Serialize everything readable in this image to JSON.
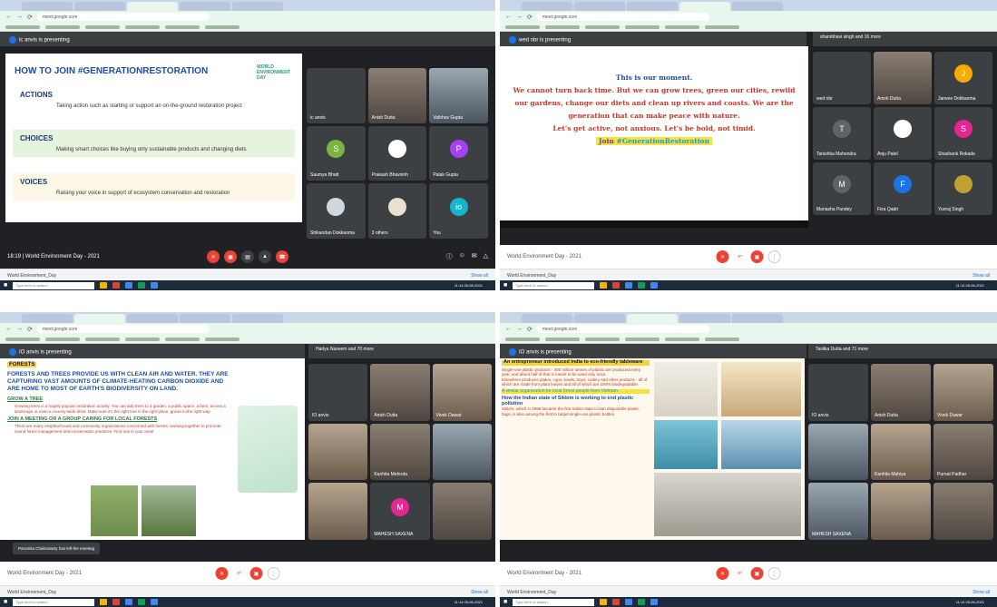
{
  "shot1": {
    "banner": "ic anvis is presenting",
    "slide": {
      "title": "HOW TO JOIN #GENERATIONRESTORATION",
      "logo": "WORLD ENVIRONMENT DAY",
      "sections": [
        {
          "title": "ACTIONS",
          "text": "Taking action such as starting or support an on-the-ground restoration project"
        },
        {
          "title": "CHOICES",
          "text": "Making smart choices like buying only sustainable products and changing diets"
        },
        {
          "title": "VOICES",
          "text": "Raising your voice in support of ecosystem conservation and restoration"
        }
      ]
    },
    "tiles": [
      {
        "name": "ic anvis",
        "letter": "",
        "color": "#3c4043"
      },
      {
        "name": "Anish Dutta",
        "letter": "",
        "color": ""
      },
      {
        "name": "Vaibhav Gupta",
        "letter": "",
        "color": "#3c4043"
      },
      {
        "name": "Saumya Bhatt",
        "letter": "S",
        "color": "#7cb342"
      },
      {
        "name": "Prakash Bhavsinh",
        "letter": "",
        "color": "#3c4043"
      },
      {
        "name": "Palak Gupta",
        "letter": "P",
        "color": "#a142f4"
      },
      {
        "name": "Shikandan Dokkaoma",
        "letter": "",
        "color": "#3c4043"
      },
      {
        "name": "3 others",
        "letter": "",
        "color": "#3c4043"
      },
      {
        "name": "You",
        "letter": "io",
        "color": "#12b5cb"
      }
    ],
    "meeting": "18:19 | World Environment Day - 2021"
  },
  "shot2": {
    "banner": "wed nbr is presenting",
    "participants_note": "shambhavi singh and 16 more",
    "moment": {
      "heading": "This is our moment.",
      "body": "We cannot turn back time. But we can grow trees, green our cities, rewild our gardens, change our diets and clean up rivers and coasts. We are the generation that can make peace with nature.",
      "tagline": "Let's get active, not anxious. Let's be bold, not timid.",
      "join": "Join",
      "hashtag": "#GenerationRestoration"
    },
    "tiles": [
      {
        "name": "wed nbr",
        "letter": "",
        "color": ""
      },
      {
        "name": "Anish Dutta",
        "letter": "",
        "color": ""
      },
      {
        "name": "Janvee Dokkaoma",
        "letter": "J",
        "color": "#f9ab00"
      },
      {
        "name": "Tanishka Mahendra",
        "letter": "T",
        "color": "#5f6368"
      },
      {
        "name": "Anju Patel",
        "letter": "",
        "color": "#3c4043"
      },
      {
        "name": "Shashank Rokade",
        "letter": "S",
        "color": "#e52592"
      },
      {
        "name": "Manasha Pandey",
        "letter": "M",
        "color": "#5f6368"
      },
      {
        "name": "Fiza Qadri",
        "letter": "F",
        "color": "#1a73e8"
      },
      {
        "name": "Yuvraj Singh",
        "letter": "",
        "color": "#3c4043"
      }
    ],
    "meeting": "World Environment Day - 2021"
  },
  "shot3": {
    "banner": "IO anvis is presenting",
    "participants_note": "Harlya Naseem and 70 more",
    "forest": {
      "label": "FORESTS",
      "headline": "FORESTS AND TREES PROVIDE US WITH CLEAN AIR AND WATER. THEY ARE CAPTURING VAST AMOUNTS OF CLIMATE-HEATING CARBON DIOXIDE AND ARE HOME TO MOST OF EARTH'S BIODIVERSITY ON LAND.",
      "sub1": "GROW A TREE",
      "p1": "Growing trees is a hugely popular restoration activity. You can add trees to a garden, a public space, a farm, across a landscape or even a country-wide drive. Make sure it's the right tree in the right place, grown in the right way.",
      "sub2": "JOIN A MEETING OR A GROUP CARING FOR LOCAL FORESTS",
      "p2": "There are many neighborhoods and community organizations concerned with forests, working together to promote sound forest management and conservation practices. Find one in your area!"
    },
    "toast": "Paromita Chakravarty has left the meeting",
    "tiles": [
      {
        "name": "IO anvis",
        "letter": "",
        "color": "#3c4043"
      },
      {
        "name": "Anish Dutta",
        "letter": "",
        "color": ""
      },
      {
        "name": "Vivek Dawat",
        "letter": "",
        "color": ""
      },
      {
        "name": "",
        "letter": "",
        "color": ""
      },
      {
        "name": "Kanhita Mehrota",
        "letter": "",
        "color": ""
      },
      {
        "name": "",
        "letter": "",
        "color": ""
      },
      {
        "name": "",
        "letter": "",
        "color": ""
      },
      {
        "name": "MAHESH SAXENA",
        "letter": "M",
        "color": "#e52592"
      },
      {
        "name": "",
        "letter": "",
        "color": ""
      }
    ],
    "meeting": "World Environment Day - 2021"
  },
  "shot4": {
    "banner": "IO anvis is presenting",
    "participants_note": "Taslika Dutta and 71 more",
    "eco": {
      "h1": "An entrepreneur introduced India to eco-friendly tableware",
      "p1": "Single-use plastic products - 300 million tonnes of plastic are produced every year, and about half of that is meant to be used only once.",
      "p2": "Elsewhere produces plates, cups, bowls, trays, cutlery and other products - all of which are made from plant leaves and all of which are 100% biodegradable.",
      "hl": "A similar organization for local forest people from  Vietnam",
      "h2": "How the Indian state of Sikkim is working to end plastic pollution",
      "p3": "Sikkim, which in 1998 became the first Indian state to ban disposable plastic bags, is also among the first to target single-use plastic bottles."
    },
    "tiles": [
      {
        "name": "IO anvis",
        "letter": "",
        "color": "#3c4043"
      },
      {
        "name": "Anish Dutta",
        "letter": "",
        "color": ""
      },
      {
        "name": "Vivek Dawar",
        "letter": "",
        "color": ""
      },
      {
        "name": "",
        "letter": "",
        "color": ""
      },
      {
        "name": "Kanhita Mahiya",
        "letter": "",
        "color": ""
      },
      {
        "name": "Purnat Padhar",
        "letter": "",
        "color": ""
      },
      {
        "name": "MAHESH SAXENA",
        "letter": "",
        "color": ""
      },
      {
        "name": "",
        "letter": "",
        "color": ""
      },
      {
        "name": "",
        "letter": "",
        "color": ""
      }
    ],
    "meeting": "World Environment Day - 2021"
  },
  "browser": {
    "url": "meet.google.com",
    "download_label": "World Environment_Day",
    "show_all": "Show all",
    "search_placeholder": "Type here to search",
    "clock": "11:14 05-06-2021"
  }
}
